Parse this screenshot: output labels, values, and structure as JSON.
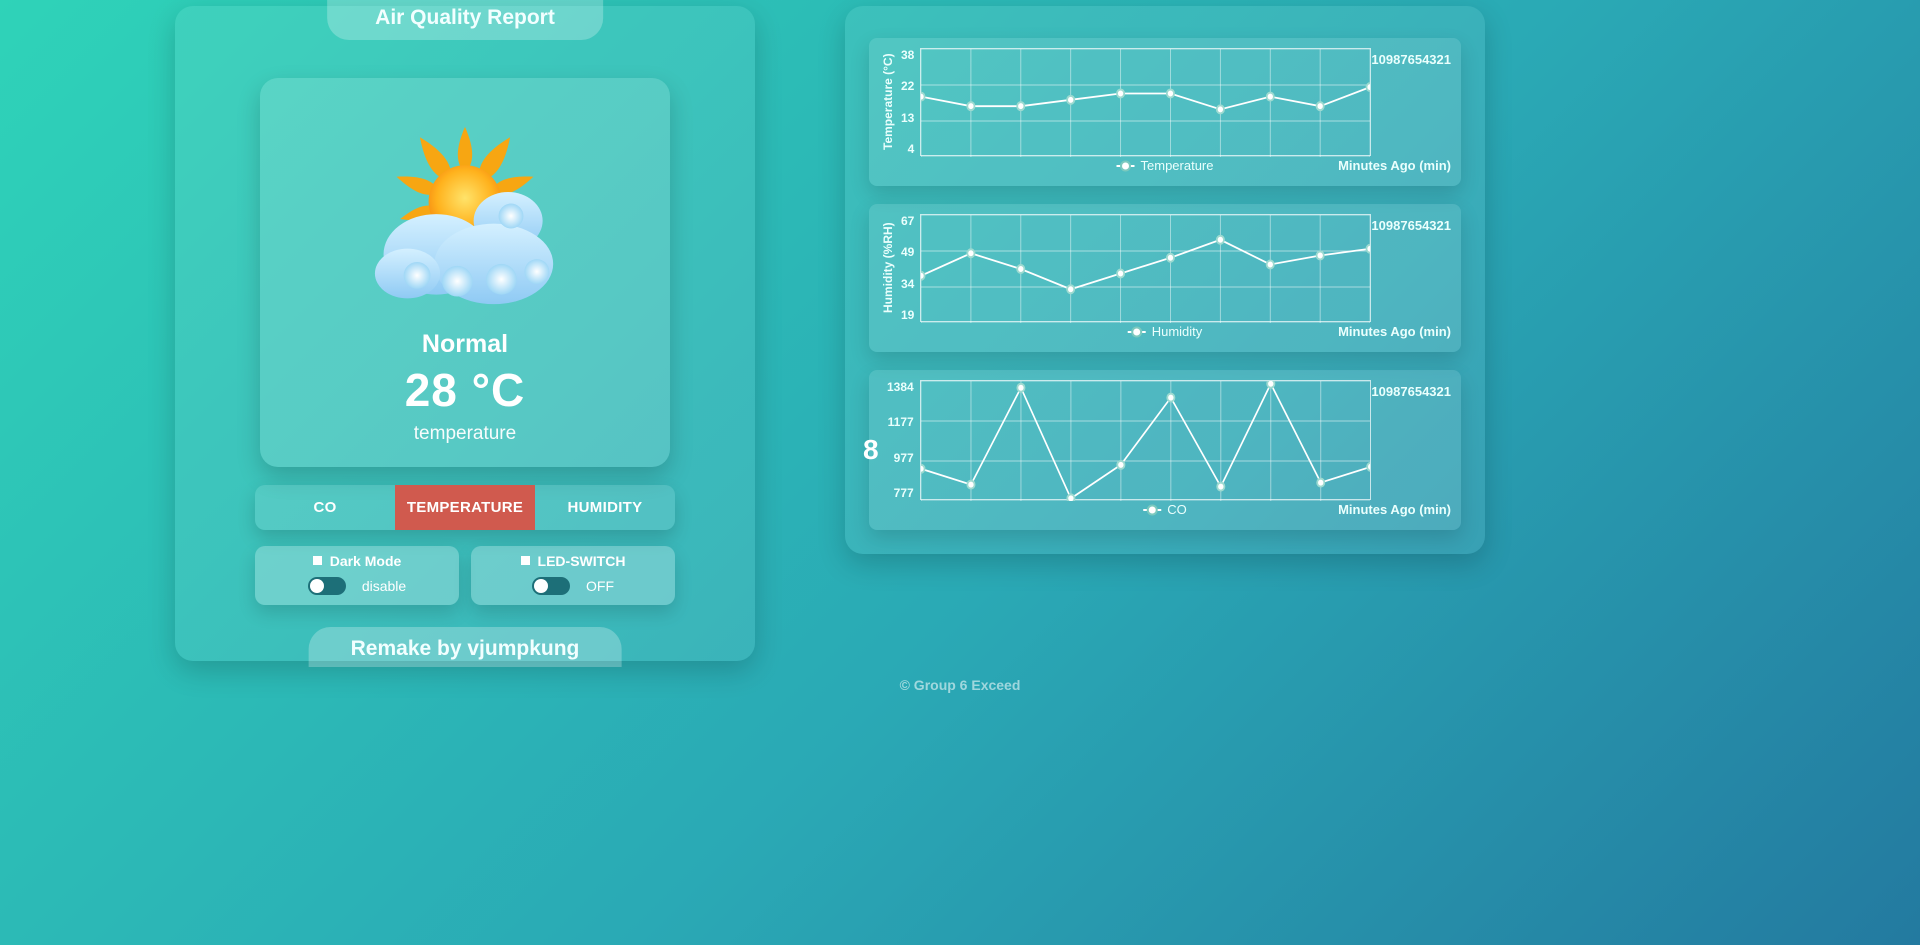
{
  "header": {
    "title": "Air Quality Report"
  },
  "footer_tab": "Remake by vjumpkung",
  "page_footer": "© Group 6 Exceed",
  "current": {
    "status": "Normal",
    "reading": "28 °C",
    "metric": "temperature"
  },
  "segments": {
    "co": "CO",
    "temperature": "TEMPERATURE",
    "humidity": "HUMIDITY"
  },
  "toggles": {
    "dark": {
      "title": "Dark Mode",
      "state": "disable"
    },
    "led": {
      "title": "LED-SWITCH",
      "state": "OFF"
    }
  },
  "charts": {
    "xlabel": "Minutes Ago (min)",
    "xcats": [
      "10",
      "9",
      "8",
      "7",
      "6",
      "5",
      "4",
      "3",
      "2",
      "1"
    ],
    "temperature": {
      "ylabel": "Temperature (°C)",
      "legend": "Temperature",
      "yticks": [
        "38",
        "22",
        "13",
        "4"
      ]
    },
    "humidity": {
      "ylabel": "Humidity (%RH)",
      "legend": "Humidity",
      "yticks": [
        "67",
        "49",
        "34",
        "19"
      ]
    },
    "co": {
      "ylabel": "",
      "legend": "CO",
      "overlay": "8",
      "yticks": [
        "1384",
        "1177",
        "977",
        "777"
      ]
    }
  },
  "chart_data": [
    {
      "type": "line",
      "title": "Temperature",
      "xlabel": "Minutes Ago (min)",
      "ylabel": "Temperature (°C)",
      "ylim": [
        4,
        38
      ],
      "categories": [
        10,
        9,
        8,
        7,
        6,
        5,
        4,
        3,
        2,
        1
      ],
      "series": [
        {
          "name": "Temperature",
          "values": [
            23,
            20,
            20,
            22,
            24,
            24,
            19,
            23,
            20,
            26
          ]
        }
      ]
    },
    {
      "type": "line",
      "title": "Humidity",
      "xlabel": "Minutes Ago (min)",
      "ylabel": "Humidity (%RH)",
      "ylim": [
        19,
        67
      ],
      "categories": [
        10,
        9,
        8,
        7,
        6,
        5,
        4,
        3,
        2,
        1
      ],
      "series": [
        {
          "name": "Humidity",
          "values": [
            40,
            50,
            43,
            34,
            41,
            48,
            56,
            45,
            49,
            52
          ]
        }
      ]
    },
    {
      "type": "line",
      "title": "CO",
      "xlabel": "Minutes Ago (min)",
      "ylabel": "",
      "ylim": [
        777,
        1384
      ],
      "categories": [
        10,
        9,
        8,
        7,
        6,
        5,
        4,
        3,
        2,
        1
      ],
      "series": [
        {
          "name": "CO",
          "values": [
            940,
            860,
            1350,
            790,
            960,
            1300,
            850,
            1370,
            870,
            950
          ]
        }
      ]
    }
  ]
}
